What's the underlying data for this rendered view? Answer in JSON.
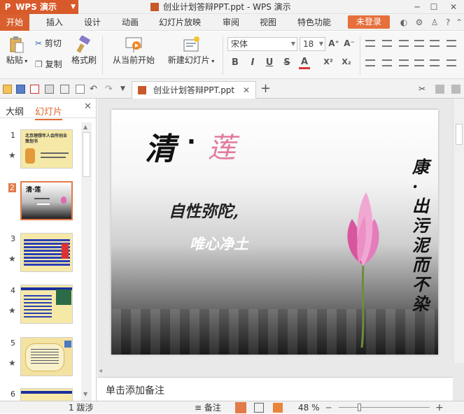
{
  "app": {
    "name": "WPS 演示",
    "logo": "P"
  },
  "window": {
    "title": "创业计划答辩PPT.ppt - WPS 演示"
  },
  "menu": {
    "items": [
      "开始",
      "插入",
      "设计",
      "动画",
      "幻灯片放映",
      "审阅",
      "视图",
      "特色功能"
    ],
    "login": "未登录"
  },
  "ribbon": {
    "paste": "粘贴",
    "cut": "剪切",
    "copy": "复制",
    "format_painter": "格式刷",
    "from_current": "从当前开始",
    "new_slide": "新建幻灯片",
    "font_name": "宋体",
    "font_size": "18",
    "bold": "B",
    "italic": "I",
    "underline": "U",
    "strike": "S",
    "font_color": "A",
    "superscript": "X²",
    "subscript": "X₂"
  },
  "document_tab": {
    "name": "创业计划答辩PPT.ppt"
  },
  "left_panel": {
    "tabs": [
      "大纲",
      "幻灯片"
    ],
    "slides": [
      {
        "num": "1",
        "title": "北京理想年人会所创业策划书"
      },
      {
        "num": "2",
        "title": "清·莲"
      },
      {
        "num": "3"
      },
      {
        "num": "4"
      },
      {
        "num": "5"
      },
      {
        "num": "6"
      }
    ]
  },
  "slide": {
    "title_char1": "清",
    "title_dot": "·",
    "title_char2": "莲",
    "line1": "自性弥陀,",
    "line2": "唯心净土",
    "vertical": "康·出污泥而不染"
  },
  "notes": {
    "placeholder": "单击添加备注"
  },
  "status": {
    "slide_info": "1  跋涉",
    "notes_label": "备注",
    "zoom": "48 %"
  },
  "colors": {
    "accent": "#d85a2a",
    "active_thumb_border": "#e27b4a",
    "lotus": "#e26ab0"
  }
}
